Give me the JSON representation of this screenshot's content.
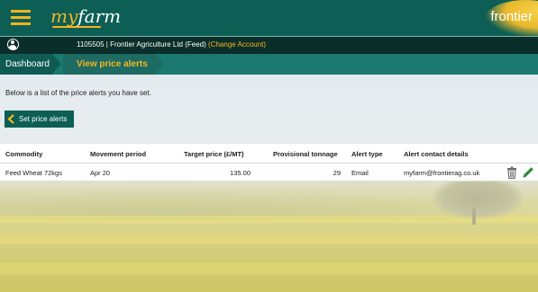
{
  "header": {
    "logo_my": "my",
    "logo_farm": "farm",
    "brand": "frontier",
    "menu_icon": "hamburger-menu-icon",
    "accent_color": "#f5b51f",
    "primary_color": "#0d5f55"
  },
  "account": {
    "user_icon": "user-circle-icon",
    "text": "1105505 | Frontier Agriculture Ltd (Feed)",
    "change_label": "(Change Account)"
  },
  "breadcrumb": {
    "items": [
      {
        "label": "Dashboard"
      },
      {
        "label": "View price alerts"
      }
    ]
  },
  "main": {
    "intro": "Below is a list of the price alerts you have set.",
    "set_alerts_button": "Set price alerts",
    "set_alerts_icon": "chevron-left-icon"
  },
  "table": {
    "columns": [
      "Commodity",
      "Movement period",
      "Target price (£/MT)",
      "Provisional tonnage",
      "Alert type",
      "Alert contact details"
    ],
    "rows": [
      {
        "commodity": "Feed Wheat 72kgs",
        "movement_period": "Apr 20",
        "target_price": "135.00",
        "provisional_tonnage": "29",
        "alert_type": "Email",
        "contact": "myfarm@frontierag.co.uk",
        "actions": [
          "trash-icon",
          "pencil-icon"
        ]
      }
    ]
  }
}
